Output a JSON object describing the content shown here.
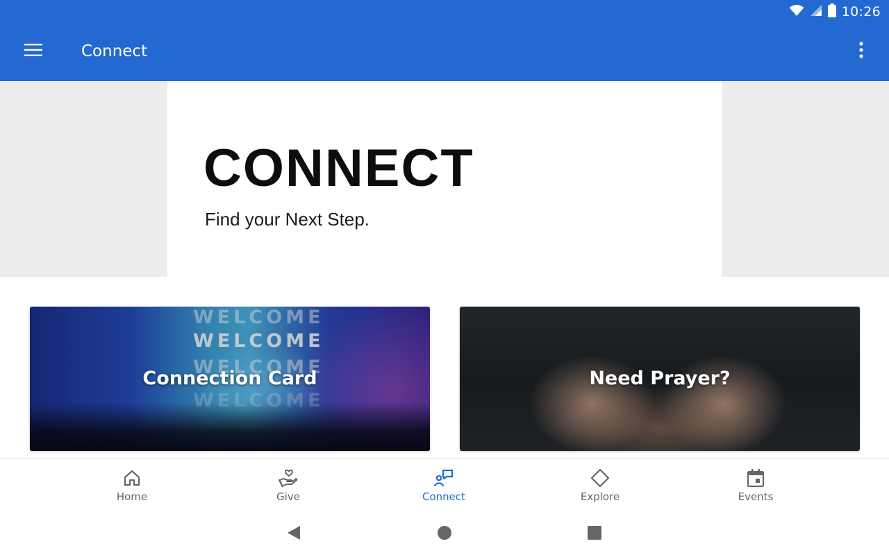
{
  "status_bar": {
    "time": "10:26",
    "icons": [
      "wifi-icon",
      "signal-icon",
      "battery-icon"
    ]
  },
  "app_bar": {
    "title": "Connect",
    "menu_icon": "menu-icon",
    "more_icon": "more-vertical-icon",
    "background_color": "#2369d1"
  },
  "hero": {
    "title": "CONNECT",
    "subtitle": "Find your Next Step."
  },
  "cards": [
    {
      "title": "Connection Card",
      "background_text": [
        "WELCOME",
        "WELCOME",
        "WELCOME",
        "WELCOME"
      ]
    },
    {
      "title": "Need Prayer?"
    }
  ],
  "bottom_nav": {
    "active_color": "#2369d1",
    "inactive_color": "#666666",
    "items": [
      {
        "label": "Home",
        "icon": "home-icon",
        "active": false
      },
      {
        "label": "Give",
        "icon": "give-hand-heart-icon",
        "active": false
      },
      {
        "label": "Connect",
        "icon": "connect-person-chat-icon",
        "active": true
      },
      {
        "label": "Explore",
        "icon": "explore-diamond-icon",
        "active": false
      },
      {
        "label": "Events",
        "icon": "calendar-icon",
        "active": false
      }
    ]
  },
  "system_nav": {
    "icons": [
      "back-icon",
      "home-circle-icon",
      "recents-square-icon"
    ]
  }
}
